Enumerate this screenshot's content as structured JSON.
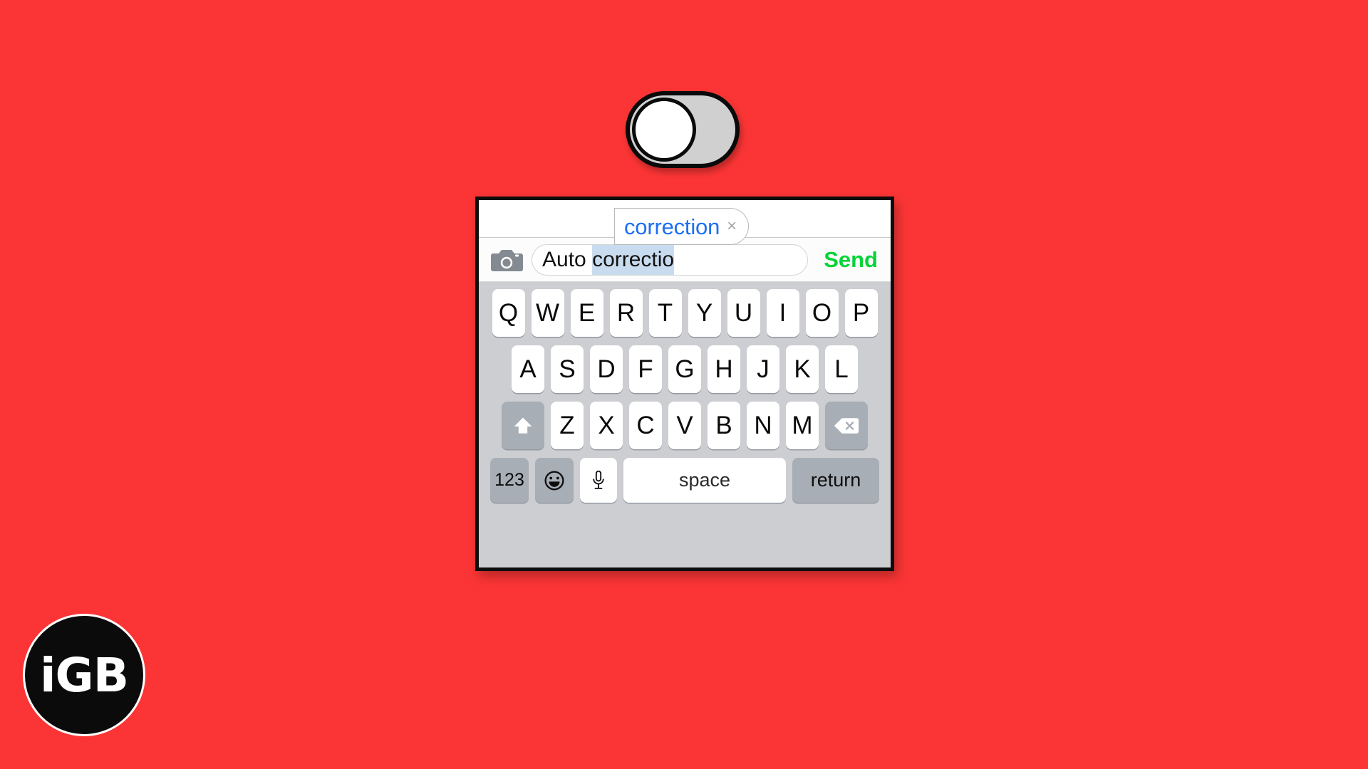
{
  "background": {
    "color": "#fb3535"
  },
  "toggle": {
    "name": "autocorrection-toggle",
    "state": "off",
    "track_color": "#d0d0d0",
    "knob_color": "#ffffff",
    "outline_color": "#0a0a0a"
  },
  "phone": {
    "correction_bubble": {
      "word": "correction",
      "dismiss": "×",
      "word_color": "#1b6ef5"
    },
    "compose": {
      "camera_icon": "camera-icon",
      "text_typed": "Auto ",
      "text_selected": "correctio",
      "send_label": "Send",
      "send_color": "#06d338",
      "selection_color": "#c9dcef"
    },
    "keyboard": {
      "row1": [
        "Q",
        "W",
        "E",
        "R",
        "T",
        "Y",
        "U",
        "I",
        "O",
        "P"
      ],
      "row2": [
        "A",
        "S",
        "D",
        "F",
        "G",
        "H",
        "J",
        "K",
        "L"
      ],
      "row3": [
        "Z",
        "X",
        "C",
        "V",
        "B",
        "N",
        "M"
      ],
      "shift_icon": "shift-arrow-icon",
      "delete_icon": "backspace-icon",
      "numbers_label": "123",
      "emoji_icon": "emoji-smiley-icon",
      "mic_icon": "microphone-icon",
      "space_label": "space",
      "return_label": "return",
      "key_color": "#ffffff",
      "modifier_color": "#a8aeb6",
      "background_color": "#ccced2"
    }
  },
  "logo": {
    "text": "iGB",
    "circle_color": "#0b0b0b",
    "text_color": "#ffffff"
  }
}
